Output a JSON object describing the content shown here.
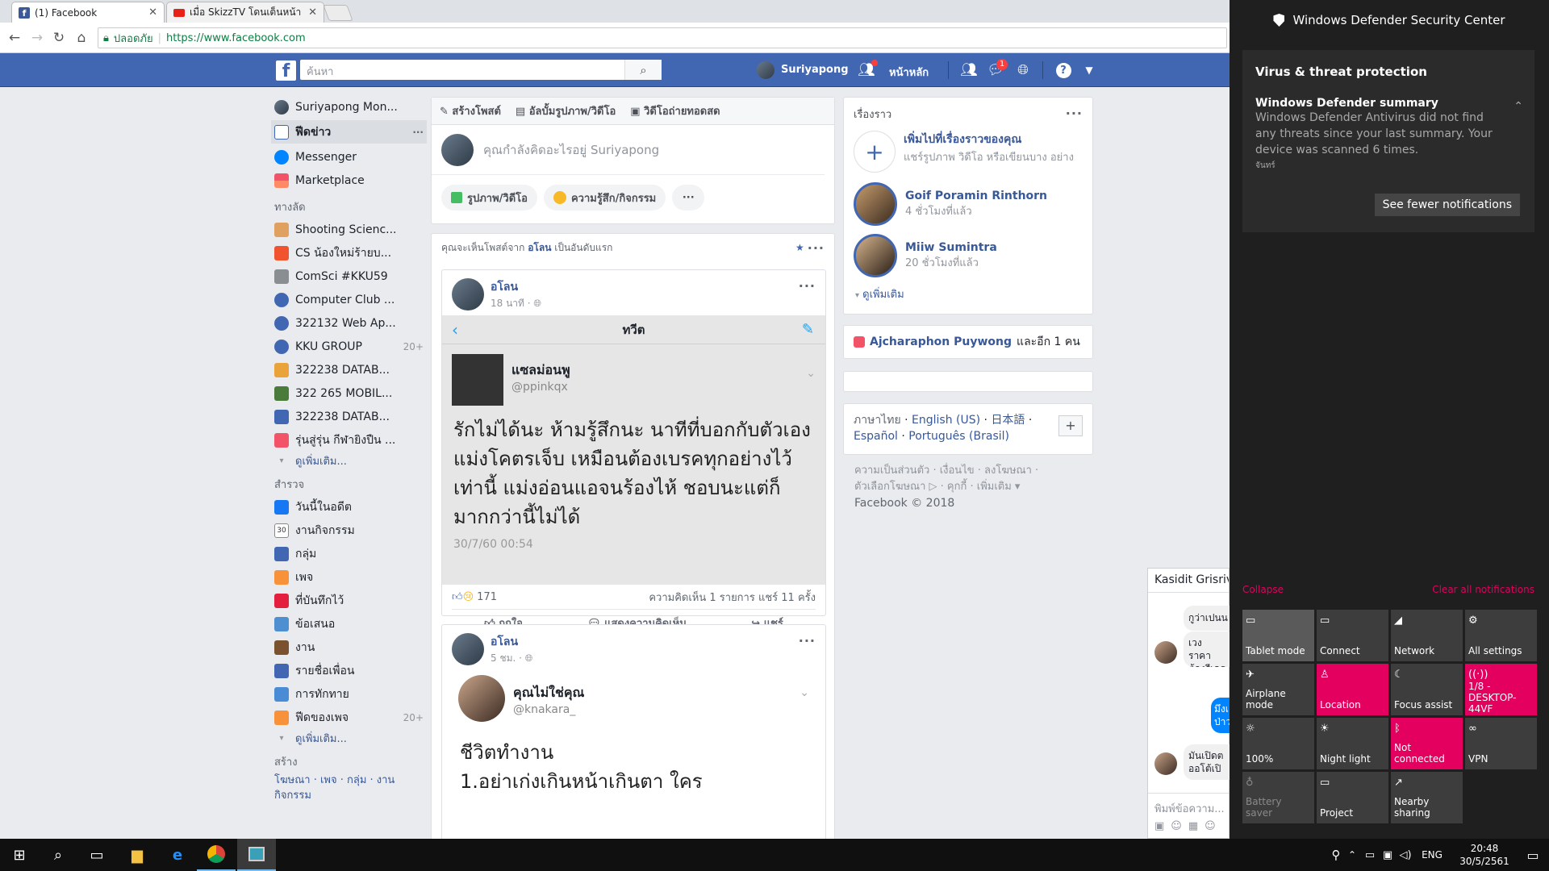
{
  "browser": {
    "tabs": [
      {
        "title": "(1) Facebook",
        "active": true
      },
      {
        "title": "เมื่อ SkizzTV โดนเต็นหน้า -",
        "active": false
      }
    ],
    "secure_label": "ปลอดภัย",
    "url": "https://www.facebook.com"
  },
  "fb_header": {
    "search_placeholder": "ค้นหา",
    "profile_name": "Suriyapong",
    "home_label": "หน้าหลัก",
    "message_badge": "1",
    "colors": {
      "brand": "#4267b2",
      "badge": "#fa3e3e"
    }
  },
  "left_nav": {
    "profile": "Suriyapong Mon...",
    "main": [
      {
        "label": "ฟีดข่าว",
        "icon": "newsfeed-icon"
      },
      {
        "label": "Messenger",
        "icon": "messenger-icon"
      },
      {
        "label": "Marketplace",
        "icon": "marketplace-icon"
      }
    ],
    "shortcuts_title": "ทางลัด",
    "shortcuts": [
      {
        "label": "Shooting Scienc...",
        "count": ""
      },
      {
        "label": "CS น้องใหม่ร้ายบ...",
        "count": ""
      },
      {
        "label": "ComSci #KKU59",
        "count": ""
      },
      {
        "label": "Computer Club ...",
        "count": ""
      },
      {
        "label": "322132 Web Ap...",
        "count": ""
      },
      {
        "label": "KKU GROUP",
        "count": "20+"
      },
      {
        "label": "322238 DATAB...",
        "count": ""
      },
      {
        "label": "322 265 MOBIL...",
        "count": ""
      },
      {
        "label": "322238 DATAB...",
        "count": ""
      },
      {
        "label": "รุ่นสู่รุ่น กีฬายิงปืน ...",
        "count": ""
      }
    ],
    "see_more": "ดูเพิ่มเติม...",
    "explore_title": "สำรวจ",
    "explore": [
      {
        "label": "วันนี้ในอดีต",
        "count": ""
      },
      {
        "label": "งานกิจกรรม",
        "count": ""
      },
      {
        "label": "กลุ่ม",
        "count": ""
      },
      {
        "label": "เพจ",
        "count": ""
      },
      {
        "label": "ที่บันทึกไว้",
        "count": ""
      },
      {
        "label": "ข้อเสนอ",
        "count": ""
      },
      {
        "label": "งาน",
        "count": ""
      },
      {
        "label": "รายชื่อเพื่อน",
        "count": ""
      },
      {
        "label": "การทักทาย",
        "count": ""
      },
      {
        "label": "ฟีดของเพจ",
        "count": "20+"
      }
    ],
    "see_more2": "ดูเพิ่มเติม...",
    "create_title": "สร้าง",
    "create_links": "โฆษณา · เพจ · กลุ่ม · งาน",
    "create_links2": "กิจกรรม",
    "calendar_day": "30"
  },
  "composer": {
    "tab_post": "สร้างโพสต์",
    "tab_album": "อัลบั้มรูปภาพ/วิดีโอ",
    "tab_live": "วิดีโอถ่ายทอดสด",
    "placeholder": "คุณกำลังคิดอะไรอยู่ Suriyapong",
    "btn_photo": "รูปภาพ/วิดีโอ",
    "btn_feeling": "ความรู้สึก/กิจกรรม"
  },
  "feed": {
    "see_first_prefix": "คุณจะเห็นโพสต์จาก",
    "see_first_name": "อโลน",
    "see_first_suffix": "เป็นอันดับแรก",
    "post1": {
      "author": "อโลน",
      "time": "18 นาที ·",
      "tweet_header": "ทวีต",
      "tweet_name": "แซลม่อนพู",
      "tweet_handle": "@ppinkqx",
      "tweet_text": "รักไม่ได้นะ ห้ามรู้สึกนะ นาทีที่บอกกับตัวเอง แม่งโคตรเจ็บ เหมือนต้องเบรคทุกอย่างไว้ เท่านี้ แม่งอ่อนแอจนร้องไห้ ชอบนะแต่ก็มากกว่านี้ไม่ได้",
      "tweet_date": "30/7/60 00:54",
      "reactions": "171",
      "comments_shares": "ความคิดเห็น 1 รายการ  แชร์ 11 ครั้ง",
      "btn_like": "ถูกใจ",
      "btn_comment": "แสดงความคิดเห็น",
      "btn_share": "แชร์"
    },
    "post2": {
      "author": "อโลน",
      "time": "5 ชม. ·",
      "tweet_name": "คุณไม่ใช่คุณ",
      "tweet_handle": "@knakara_",
      "text_line1": "ชีวิตทำงาน",
      "text_line2": "1.อย่าเก่งเกินหน้าเกินตา ใคร"
    }
  },
  "right_col": {
    "stories_title": "เรื่องราว",
    "add_story_title": "เพิ่มไปที่เรื่องราวของคุณ",
    "add_story_sub": "แชร์รูปภาพ วิดีโอ หรือเขียนบาง อย่าง",
    "stories": [
      {
        "name": "Goif Poramin Rinthorn",
        "time": "4 ชั่วโมงที่แล้ว"
      },
      {
        "name": "Miiw Sumintra",
        "time": "20 ชั่วโมงที่แล้ว"
      }
    ],
    "see_more": "ดูเพิ่มเติม",
    "birthday_name": "Ajcharaphon Puywong",
    "birthday_more": "และอีก 1 คน",
    "lang_current": "ภาษาไทย",
    "lang_links": [
      "English (US)",
      "日本語",
      "Español",
      "Português (Brasil)"
    ],
    "footer_line1": "ความเป็นส่วนตัว · เงื่อนไข · ลงโฆษณา ·",
    "footer_line2": "ตัวเลือกโฆษณา ▷ · คุกกี้ · เพิ่มเติม ▾",
    "copyright": "Facebook © 2018"
  },
  "chat": {
    "header": "Kasidit Grisriva",
    "msg1": "กูว่าเปนน",
    "msg2": "เวง ราคา ต้องรีเคร",
    "msg3": "มึงเ ป่าว",
    "msg4": "มันเปิดต ออโต้เปิ",
    "input_placeholder": "พิมพ์ข้อความ..."
  },
  "action_center": {
    "app_title": "Windows Defender Security Center",
    "section": "Virus & threat protection",
    "summary_title": "Windows Defender summary",
    "summary_body": "Windows Defender Antivirus did not find any threats since your last summary.  Your device was scanned 6 times.",
    "day": "จันทร์",
    "btn_fewer": "See fewer notifications",
    "collapse": "Collapse",
    "clear_all": "Clear all notifications",
    "tiles": [
      {
        "label": "Tablet mode",
        "icon": "tablet-mode-icon",
        "state": "off"
      },
      {
        "label": "Connect",
        "icon": "connect-icon",
        "state": "off"
      },
      {
        "label": "Network",
        "icon": "network-icon",
        "state": "off"
      },
      {
        "label": "All settings",
        "icon": "settings-icon",
        "state": "off"
      },
      {
        "label": "Airplane mode",
        "icon": "airplane-icon",
        "state": "off"
      },
      {
        "label": "Location",
        "icon": "location-icon",
        "state": "on"
      },
      {
        "label": "Focus assist",
        "icon": "focus-assist-icon",
        "state": "off"
      },
      {
        "label": "1/8 - DESKTOP-44VF",
        "icon": "hotspot-icon",
        "state": "on"
      },
      {
        "label": "100%",
        "icon": "brightness-icon",
        "state": "off"
      },
      {
        "label": "Night light",
        "icon": "night-light-icon",
        "state": "off"
      },
      {
        "label": "Not connected",
        "icon": "bluetooth-icon",
        "state": "on"
      },
      {
        "label": "VPN",
        "icon": "vpn-icon",
        "state": "off"
      },
      {
        "label": "Battery saver",
        "icon": "battery-saver-icon",
        "state": "dim"
      },
      {
        "label": "Project",
        "icon": "project-icon",
        "state": "off"
      },
      {
        "label": "Nearby sharing",
        "icon": "nearby-sharing-icon",
        "state": "off"
      }
    ],
    "accent": "#e3005e"
  },
  "taskbar": {
    "lang": "ENG",
    "time": "20:48",
    "date": "30/5/2561"
  }
}
